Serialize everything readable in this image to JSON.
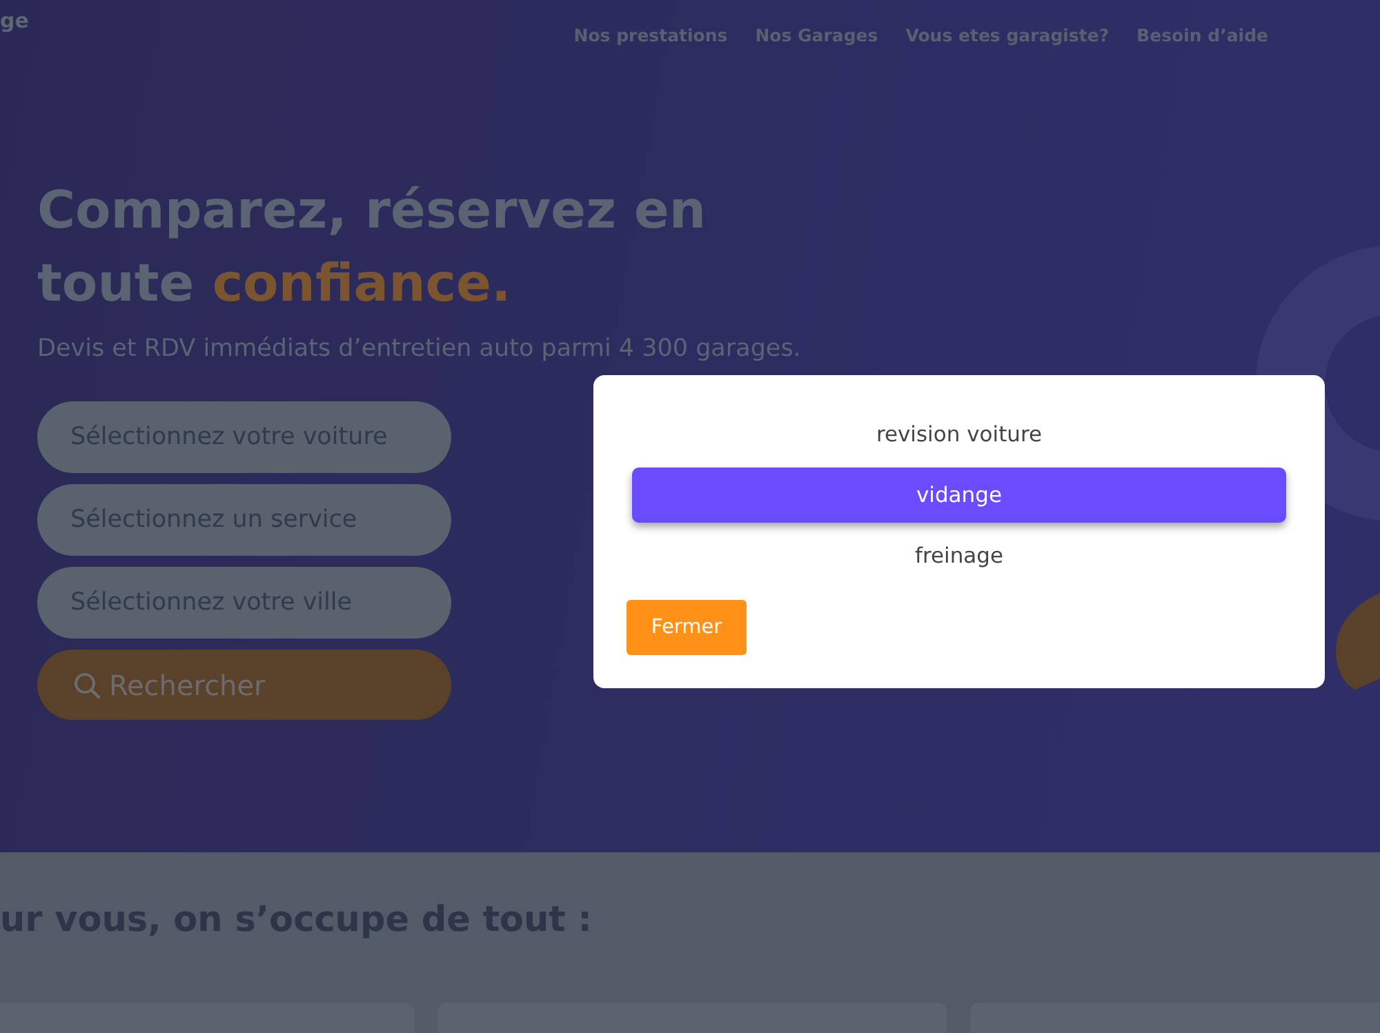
{
  "logo": {
    "text": "ge"
  },
  "nav": {
    "links": [
      "Nos prestations",
      "Nos Garages",
      "Vous etes garagiste?",
      "Besoin d’aide"
    ]
  },
  "hero": {
    "title": "Comparez, réservez en toute",
    "title_accent": "confiance.",
    "subtitle": "Devis et RDV immédiats d’entretien auto parmi 4 300 garages.",
    "fields": [
      {
        "placeholder": "Sélectionnez votre voiture"
      },
      {
        "placeholder": "Sélectionnez un service"
      },
      {
        "placeholder": "Sélectionnez votre ville"
      }
    ],
    "search_button": "Rechercher"
  },
  "section": {
    "heading": "ur vous, on s’occupe de tout :"
  },
  "modal": {
    "options": [
      {
        "label": "revision voiture",
        "selected": false
      },
      {
        "label": "vidange",
        "selected": true
      },
      {
        "label": "freinage",
        "selected": false
      }
    ],
    "close_button": "Fermer"
  }
}
